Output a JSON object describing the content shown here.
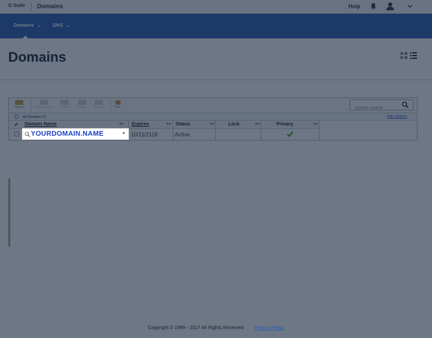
{
  "topbar": {
    "brand": "G Suite",
    "app_name": "Domains",
    "help": "Help",
    "icons": [
      "bell-icon",
      "user-icon",
      "chevron-down-icon"
    ]
  },
  "nav": {
    "items": [
      {
        "label": "Domains"
      },
      {
        "label": "DNS"
      }
    ]
  },
  "page": {
    "title": "Domains"
  },
  "toolbar": {
    "organize": "Organize",
    "nameservers": "Nameservers",
    "forward": "Forward",
    "lock": "Lock",
    "contacts": "Contacts",
    "more": "More",
    "search_placeholder": "Domain Search"
  },
  "allbar": {
    "label": "All Domains (1)",
    "edit_columns": "Edit columns"
  },
  "table": {
    "headers": [
      "Domain Name",
      "Expires",
      "Status",
      "Lock",
      "Privacy"
    ],
    "rows": [
      {
        "domain": "YOURDOMAIN.NAME",
        "expires": "10/11/2118",
        "status": "Active",
        "lock": "",
        "privacy": "check"
      }
    ]
  },
  "footer": {
    "copyright": "Copyright © 1999 - 2017 All Rights Reserved.",
    "privacy_link": "Privacy Policy"
  },
  "colors": {
    "nav_blue": "#2a5db0",
    "overlay": "#14233c",
    "domain_highlight": "#1a3fc4"
  }
}
